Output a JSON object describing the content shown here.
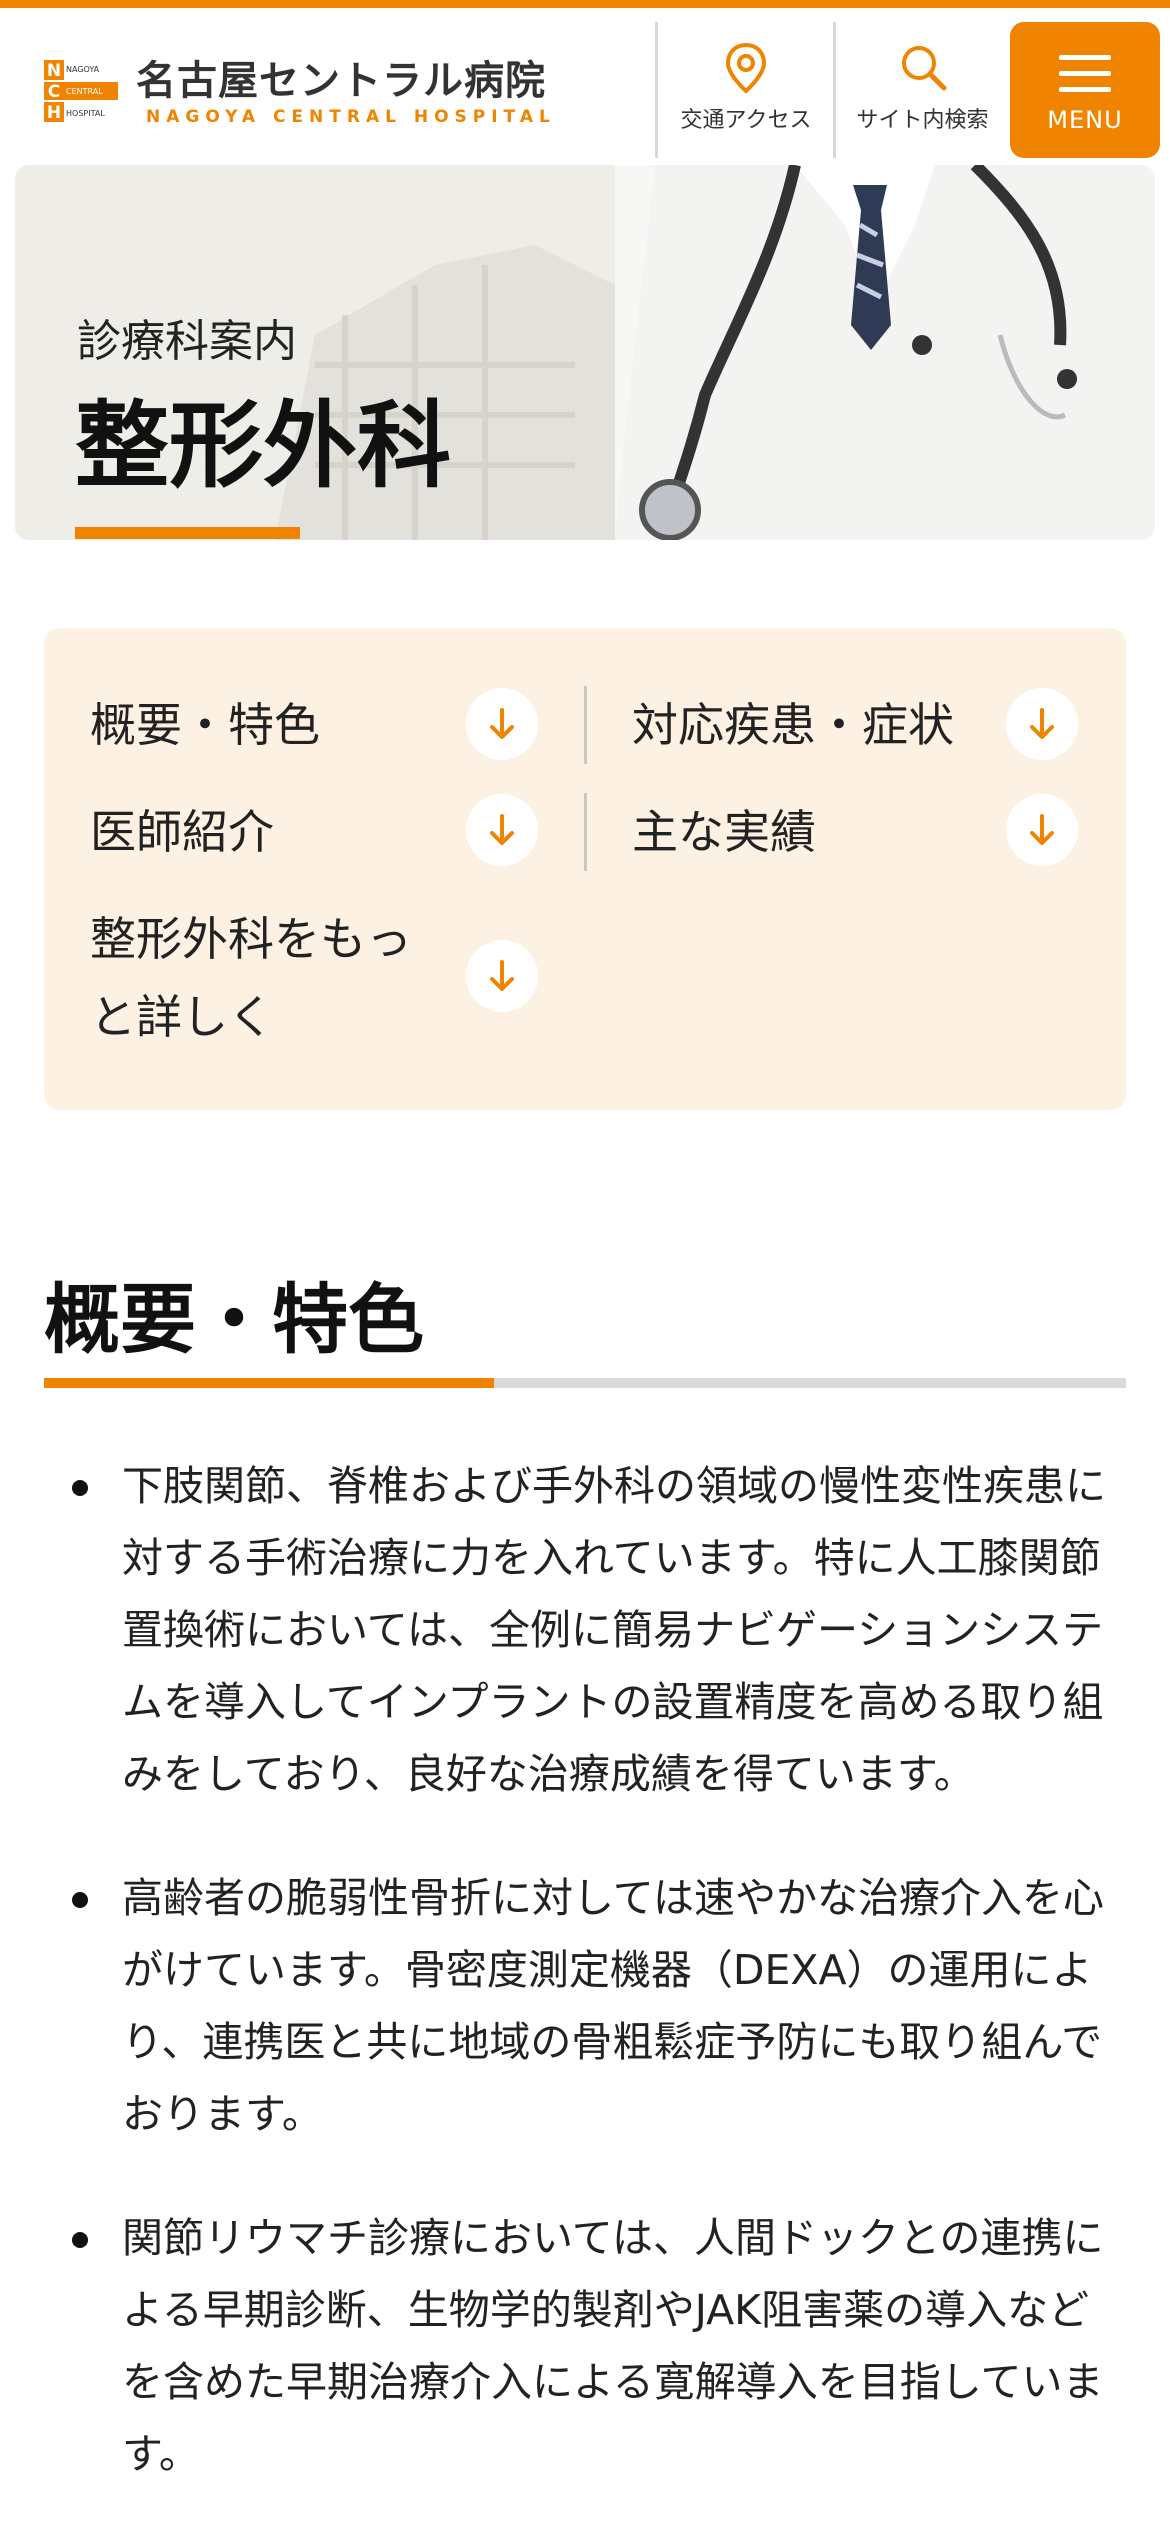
{
  "header": {
    "logo_ja": "名古屋セントラル病院",
    "logo_en": "NAGOYA CENTRAL HOSPITAL",
    "logo_mark_lines": [
      "NAGOYA",
      "CENTRAL",
      "HOSPITAL"
    ],
    "access_label": "交通アクセス",
    "search_label": "サイト内検索",
    "menu_label": "MENU",
    "accent_color": "#f08300"
  },
  "hero": {
    "category": "診療科案内",
    "title": "整形外科"
  },
  "anchors": [
    {
      "label": "概要・特色"
    },
    {
      "label": "対応疾患・症状"
    },
    {
      "label": "医師紹介"
    },
    {
      "label": "主な実績"
    },
    {
      "label": "整形外科をもっと詳しく"
    }
  ],
  "section": {
    "title": "概要・特色",
    "bullets": [
      "下肢関節、脊椎および手外科の領域の慢性変性疾患に対する手術治療に力を入れています。特に人工膝関節置換術においては、全例に簡易ナビゲーションシステムを導入してインプラントの設置精度を高める取り組みをしており、良好な治療成績を得ています。",
      "高齢者の脆弱性骨折に対しては速やかな治療介入を心がけています。骨密度測定機器（DEXA）の運用により、連携医と共に地域の骨粗鬆症予防にも取り組んでおります。",
      "関節リウマチ診療においては、人間ドックとの連携による早期診断、生物学的製剤やJAK阻害薬の導入などを含めた早期治療介入による寛解導入を目指しています。"
    ]
  }
}
